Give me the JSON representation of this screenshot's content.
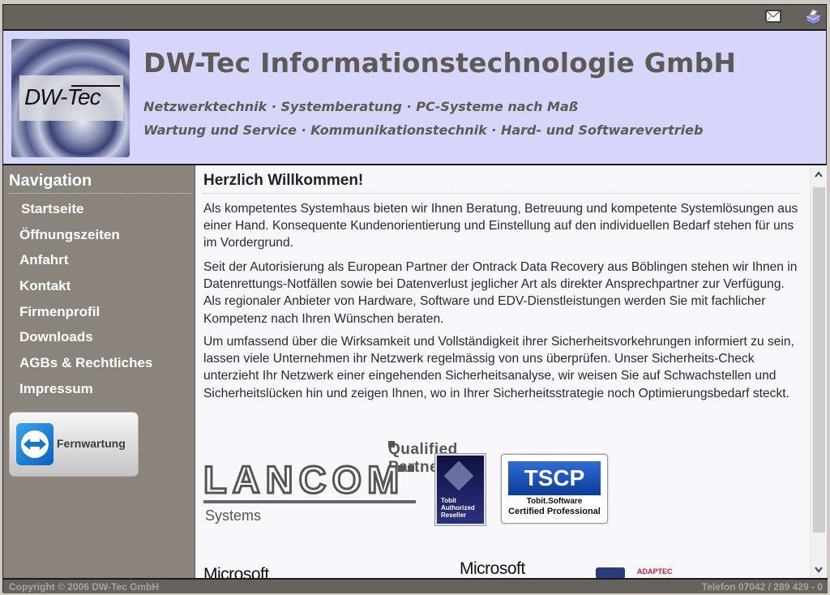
{
  "topbar": {
    "icons": [
      "mail-icon",
      "print-icon"
    ]
  },
  "header": {
    "logo_text": "DW-Tec",
    "title": "DW-Tec Informationstechnologie GmbH",
    "tagline_1": "Netzwerktechnik · Systemberatung · PC-Systeme nach Maß",
    "tagline_2": "Wartung und Service · Kommunikationstechnik · Hard- und Softwarevertrieb"
  },
  "sidebar": {
    "title": "Navigation",
    "items": [
      {
        "label": "Startseite"
      },
      {
        "label": "Öffnungszeiten"
      },
      {
        "label": "Anfahrt"
      },
      {
        "label": "Kontakt"
      },
      {
        "label": "Firmenprofil"
      },
      {
        "label": "Downloads"
      },
      {
        "label": "AGBs & Rechtliches"
      },
      {
        "label": "Impressum"
      }
    ],
    "remote_button_label": "Fernwartung"
  },
  "content": {
    "heading": "Herzlich Willkommen!",
    "paragraphs": [
      "Als kompetentes Systemhaus bieten wir Ihnen Beratung, Betreuung und kompetente Systemlösungen aus einer Hand. Konsequente Kundenorientierung und Einstellung auf den individuellen Bedarf stehen für uns im Vordergrund.",
      "Seit der Autorisierung als European Partner der Ontrack Data Recovery aus Böblingen stehen wir Ihnen in Datenrettungs-Notfällen sowie bei Datenverlust jeglicher Art als direkter Ansprechpartner zur Verfügung. Als regionaler Anbieter von Hardware, Software und EDV-Dienstleistungen werden Sie mit fachlicher Kompetenz nach Ihren Wünschen beraten.",
      "Um umfassend über die Wirksamkeit und Vollständigkeit ihrer Sicherheitsvorkehrungen informiert zu sein, lassen viele Unternehmen ihr Netzwerk regelmässig von uns überprüfen. Unser Sicherheits-Check unterzieht Ihr Netzwerk einer eingehenden Sicherheitsanalyse, wir weisen Sie auf Schwachstellen und Sicherheitslücken hin und zeigen Ihnen, wo in Ihrer Sicherheitsstrategie noch Optimierungsbedarf steckt."
    ],
    "partners": {
      "lancom_top": "Qualified Partner",
      "lancom_name": "LANCOM",
      "lancom_sub": "Systems",
      "tobit_text": "Tobit Authorized Reseller",
      "tscp_banner": "TSCP",
      "tscp_line1": "Tobit.Software",
      "tscp_line2": "Certified Professional",
      "microsoft_1": "Microsoft",
      "microsoft_2": "Microsoft",
      "adaptec": "ADAPTEC"
    }
  },
  "footer": {
    "copyright": "Copyright © 2006 DW-Tec GmbH",
    "phone": "Telefon 07042 / 289 429 - 0"
  }
}
